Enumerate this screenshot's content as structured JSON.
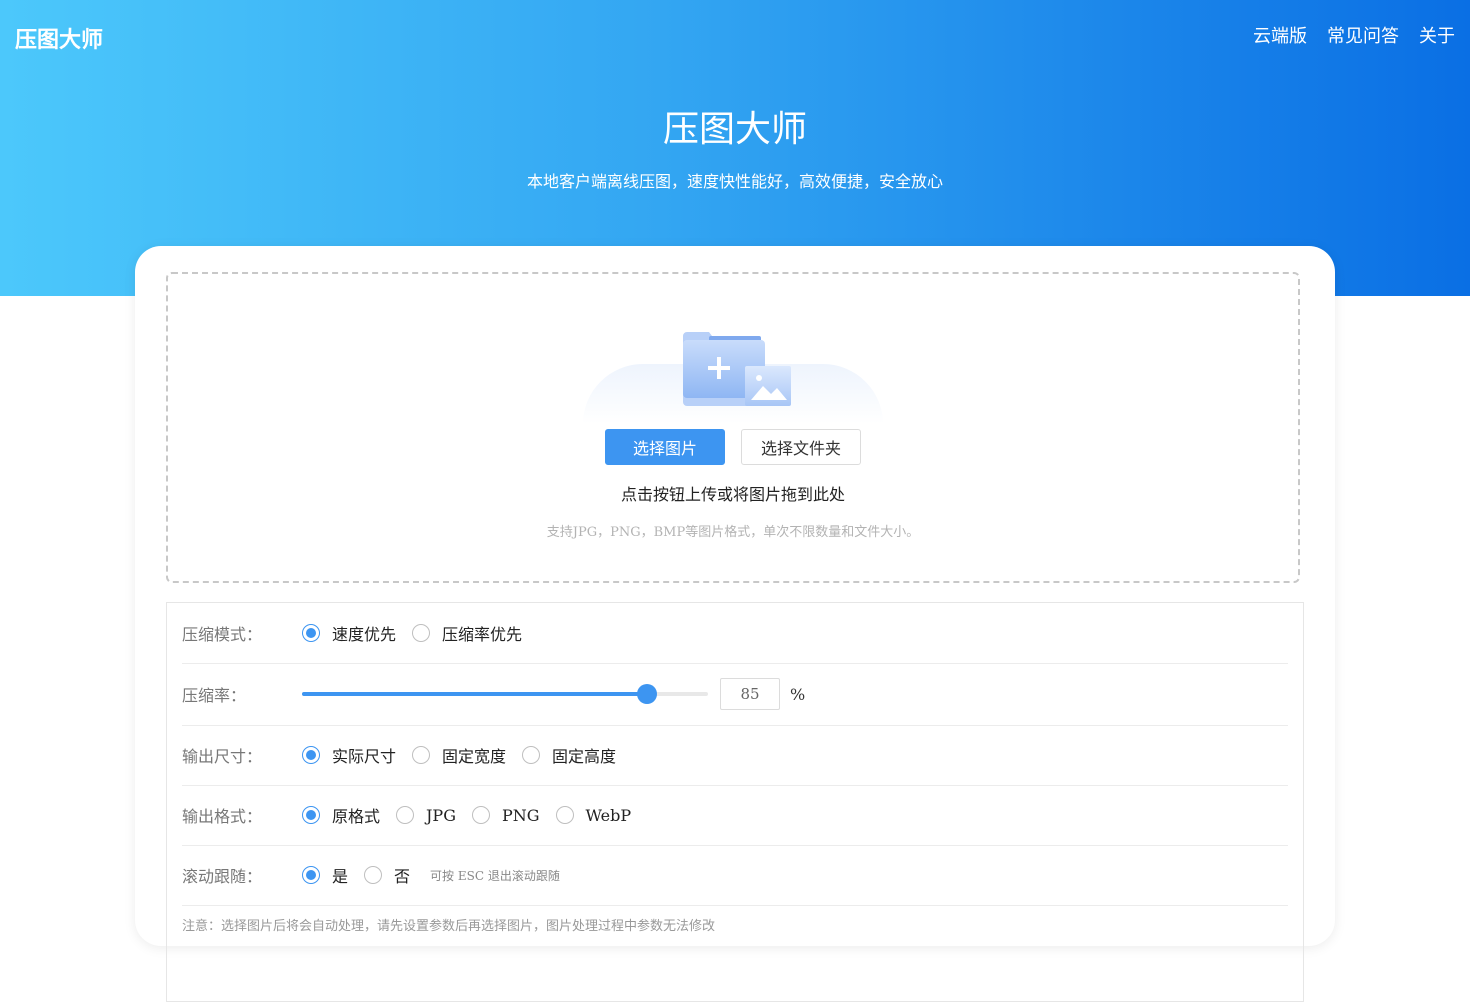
{
  "header": {
    "logo": "压图大师",
    "nav": [
      "云端版",
      "常见问答",
      "关于"
    ]
  },
  "hero": {
    "title": "压图大师",
    "subtitle": "本地客户端离线压图，速度快性能好，高效便捷，安全放心"
  },
  "upload": {
    "select_image_label": "选择图片",
    "select_folder_label": "选择文件夹",
    "hint": "点击按钮上传或将图片拖到此处",
    "note": "支持JPG，PNG，BMP等图片格式，单次不限数量和文件大小。"
  },
  "settings": {
    "mode": {
      "label": "压缩模式：",
      "options": [
        "速度优先",
        "压缩率优先"
      ],
      "selected": 0
    },
    "ratio": {
      "label": "压缩率：",
      "value": "85",
      "percent": 85,
      "unit": "%"
    },
    "size": {
      "label": "输出尺寸：",
      "options": [
        "实际尺寸",
        "固定宽度",
        "固定高度"
      ],
      "selected": 0
    },
    "format": {
      "label": "输出格式：",
      "options": [
        "原格式",
        "JPG",
        "PNG",
        "WebP"
      ],
      "selected": 0
    },
    "scroll": {
      "label": "滚动跟随：",
      "options": [
        "是",
        "否"
      ],
      "selected": 0,
      "tip": "可按 ESC 退出滚动跟随"
    },
    "footnote": "注意：选择图片后将会自动处理，请先设置参数后再选择图片，图片处理过程中参数无法修改"
  },
  "colors": {
    "accent": "#3d95f1",
    "hero_start": "#4cc8fb",
    "hero_end": "#0a6fe4"
  },
  "icons": {
    "upload_art": "folder-add-image-icon"
  }
}
